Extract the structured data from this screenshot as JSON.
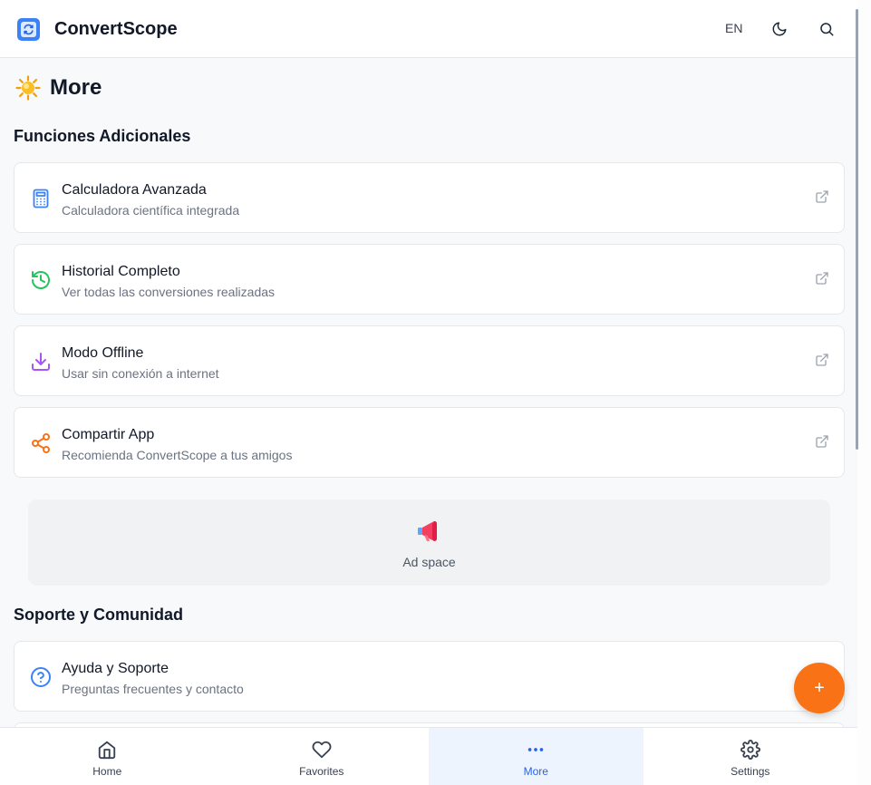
{
  "header": {
    "app_title": "ConvertScope",
    "language": "EN",
    "icons": [
      "app-logo-icon",
      "moon-icon",
      "search-icon"
    ]
  },
  "page": {
    "title": "More",
    "icon": "sun-icon"
  },
  "sections": {
    "additional": {
      "title": "Funciones Adicionales",
      "items": [
        {
          "title": "Calculadora Avanzada",
          "subtitle": "Calculadora científica integrada",
          "icon": "calculator-icon",
          "color": "#3b82f6"
        },
        {
          "title": "Historial Completo",
          "subtitle": "Ver todas las conversiones realizadas",
          "icon": "history-icon",
          "color": "#22c55e"
        },
        {
          "title": "Modo Offline",
          "subtitle": "Usar sin conexión a internet",
          "icon": "download-icon",
          "color": "#a855f7"
        },
        {
          "title": "Compartir App",
          "subtitle": "Recomienda ConvertScope a tus amigos",
          "icon": "share-icon",
          "color": "#f97316"
        }
      ]
    },
    "support": {
      "title": "Soporte y Comunidad",
      "items": [
        {
          "title": "Ayuda y Soporte",
          "subtitle": "Preguntas frecuentes y contacto",
          "icon": "help-circle-icon",
          "color": "#3b82f6"
        }
      ]
    }
  },
  "ad": {
    "label": "Ad space",
    "icon": "megaphone-icon"
  },
  "fab": {
    "label": "+"
  },
  "bottom_nav": {
    "items": [
      {
        "label": "Home",
        "icon": "home-icon",
        "active": false
      },
      {
        "label": "Favorites",
        "icon": "heart-icon",
        "active": false
      },
      {
        "label": "More",
        "icon": "more-dots-icon",
        "active": true
      },
      {
        "label": "Settings",
        "icon": "gear-icon",
        "active": false
      }
    ]
  },
  "colors": {
    "accent": "#2563eb",
    "fab": "#f97316",
    "active_nav_bg": "#eef4fd"
  }
}
